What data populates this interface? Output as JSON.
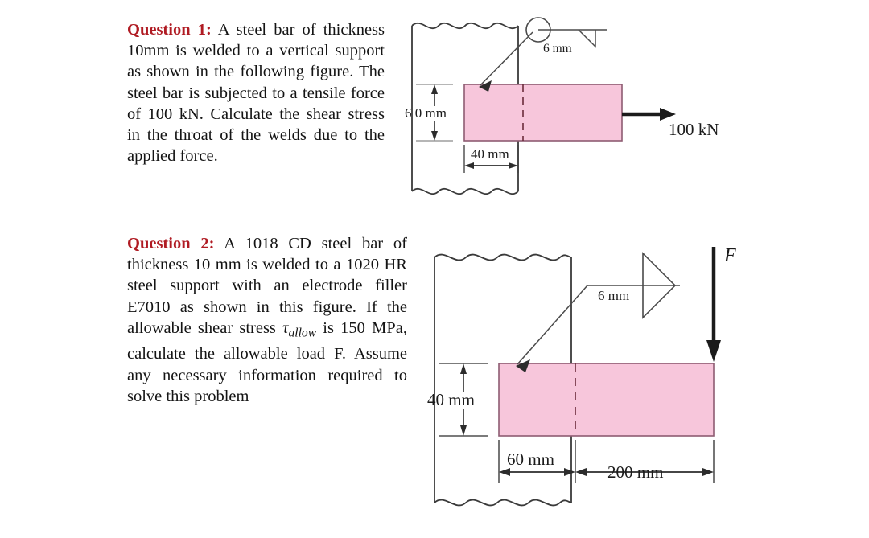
{
  "document": {
    "kind": "homework-problem-sheet",
    "background_color": "#ffffff",
    "accent_red": "#b01b23",
    "bar_fill": "#f7c6db",
    "bar_stroke": "#8e5c72",
    "line_color": "#3a3a3a"
  },
  "questions": [
    {
      "id": "q1",
      "label": "Question 1:",
      "text": " A steel bar of thickness 10mm is welded to a vertical support as shown in the following figure. The steel bar is subjected to a tensile force of 100 kN. Calculate the shear stress in the throat of the welds due to the applied force."
    },
    {
      "id": "q2",
      "label": "Question 2:",
      "text_part_1": " A 1018 CD steel bar of thickness 10 mm is welded to a 1020 HR steel support with an electrode filler E7010 as shown in this figure. If the allowable shear stress ",
      "tau_symbol": "τ",
      "tau_subscript": "allow",
      "text_part_2": " is 150 MPa, calculate the allowable load F. Assume any necessary information required to solve this problem"
    }
  ],
  "figure_1": {
    "name": "steel-bar-welded-to-vertical-support-tension",
    "weld_size_label": "6 mm",
    "height_label": "6 0 mm",
    "width_label": "40 mm",
    "force_label": "100 kN",
    "weld_symbol": "fillet-weld-all-around-triangle-down",
    "force_direction": "right-horizontal"
  },
  "figure_2": {
    "name": "steel-bar-welded-to-support-transverse-load",
    "weld_size_label": "6 mm",
    "height_label": "40 mm",
    "weld_length_label": "60 mm",
    "overhang_label": "200 mm",
    "force_label": "F",
    "weld_symbol": "fillet-weld-triangle-right",
    "force_direction": "down-vertical"
  }
}
